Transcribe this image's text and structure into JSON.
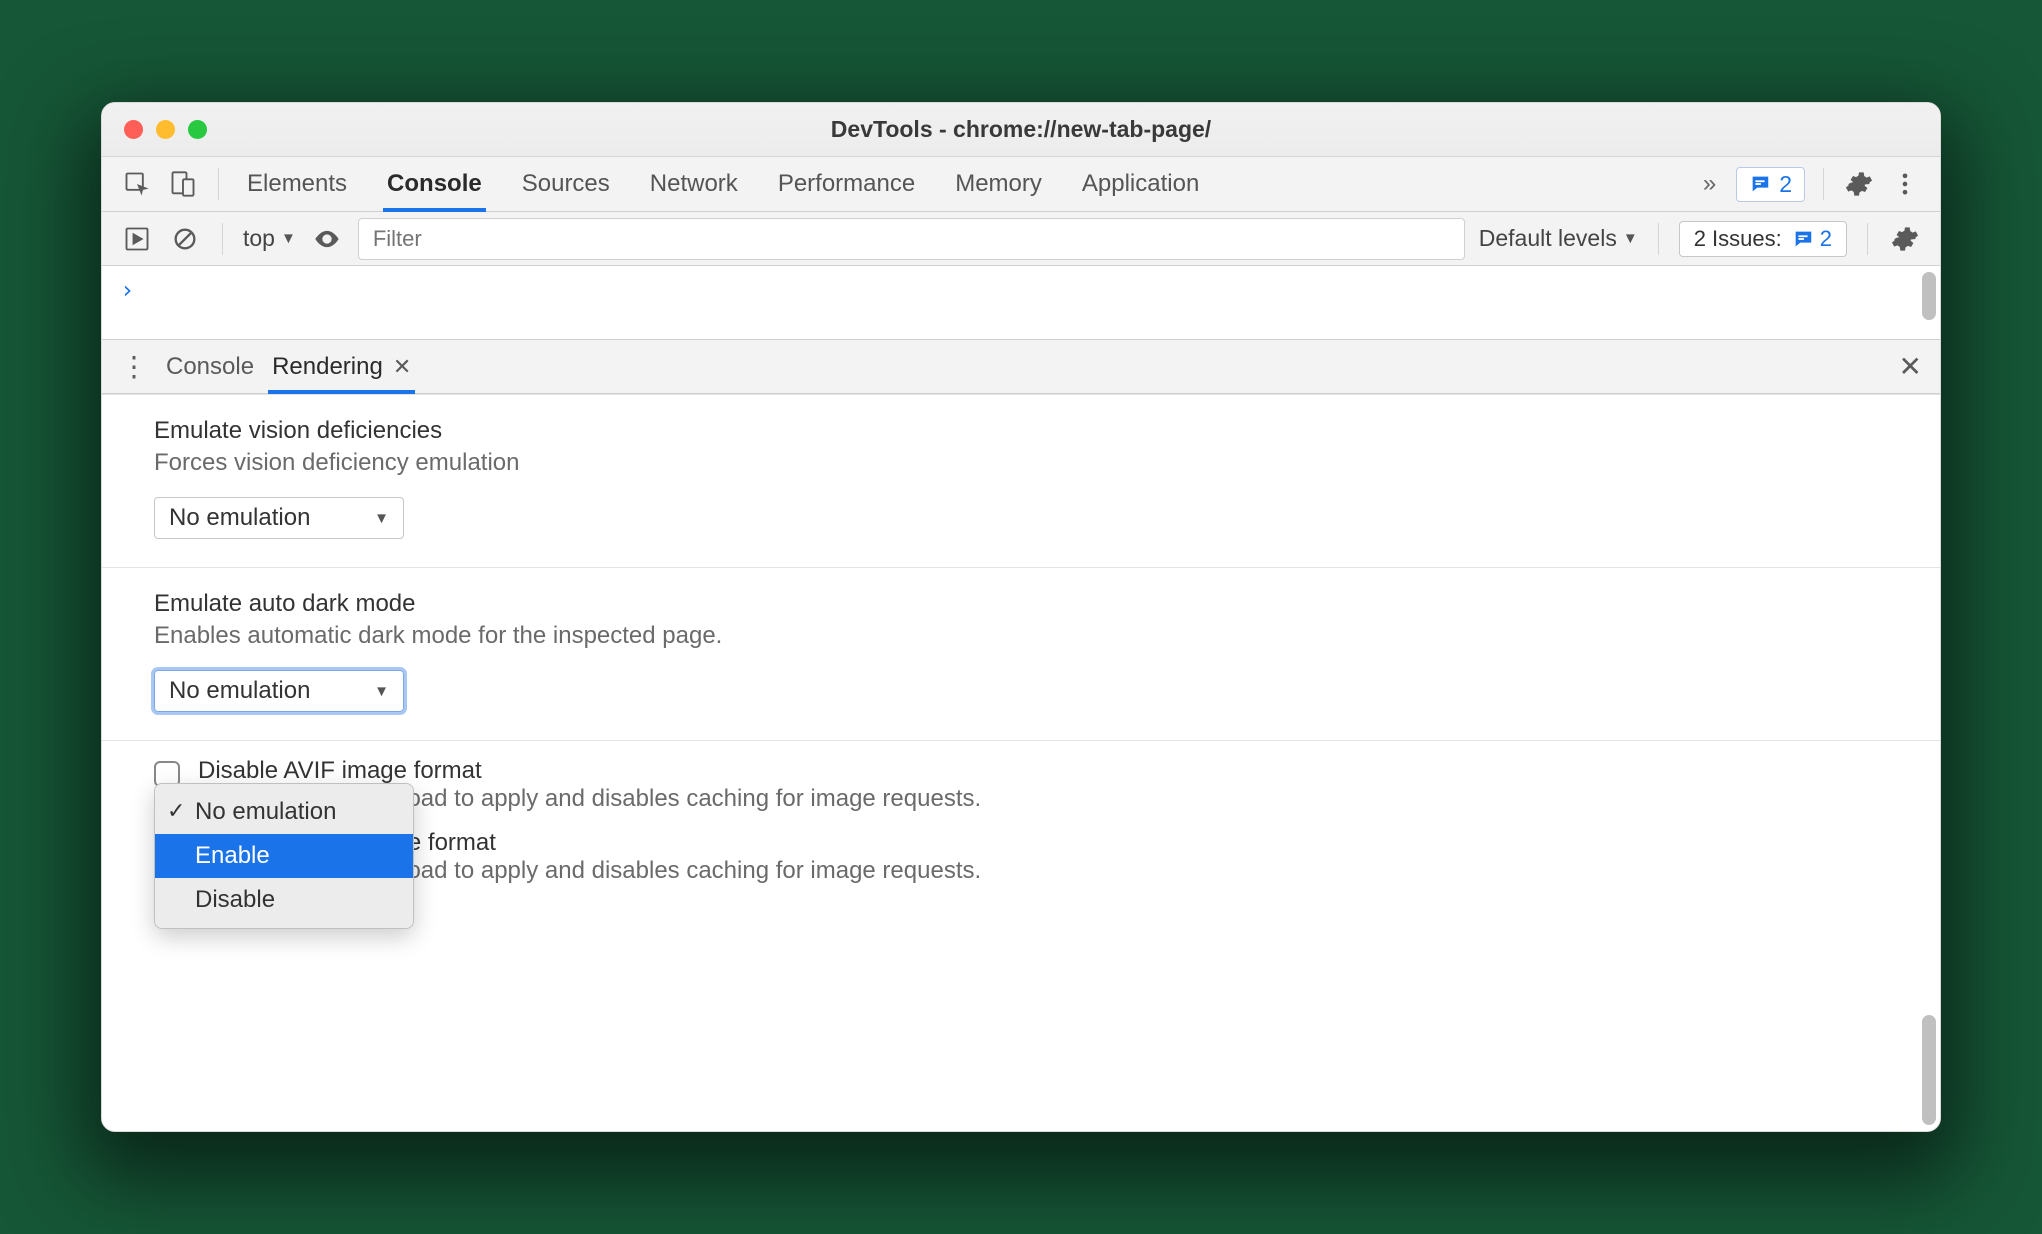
{
  "window": {
    "title": "DevTools - chrome://new-tab-page/"
  },
  "tabs": {
    "items": [
      "Elements",
      "Console",
      "Sources",
      "Network",
      "Performance",
      "Memory",
      "Application"
    ],
    "active": "Console",
    "issues_badge": "2"
  },
  "console_toolbar": {
    "context": "top",
    "filter_placeholder": "Filter",
    "levels": "Default levels",
    "issues_label": "2 Issues:",
    "issues_count": "2"
  },
  "drawer": {
    "tabs": [
      "Console",
      "Rendering"
    ],
    "active": "Rendering"
  },
  "rendering": {
    "vision": {
      "title": "Emulate vision deficiencies",
      "desc": "Forces vision deficiency emulation",
      "selected": "No emulation"
    },
    "darkmode": {
      "title": "Emulate auto dark mode",
      "desc": "Enables automatic dark mode for the inspected page.",
      "selected": "No emulation",
      "options": [
        "No emulation",
        "Enable",
        "Disable"
      ],
      "highlighted": "Enable"
    },
    "avif": {
      "title": "Disable AVIF image format",
      "desc": "Requires a page reload to apply and disables caching for image requests."
    },
    "webp": {
      "title": "Disable WebP image format",
      "desc": "Requires a page reload to apply and disables caching for image requests."
    }
  }
}
